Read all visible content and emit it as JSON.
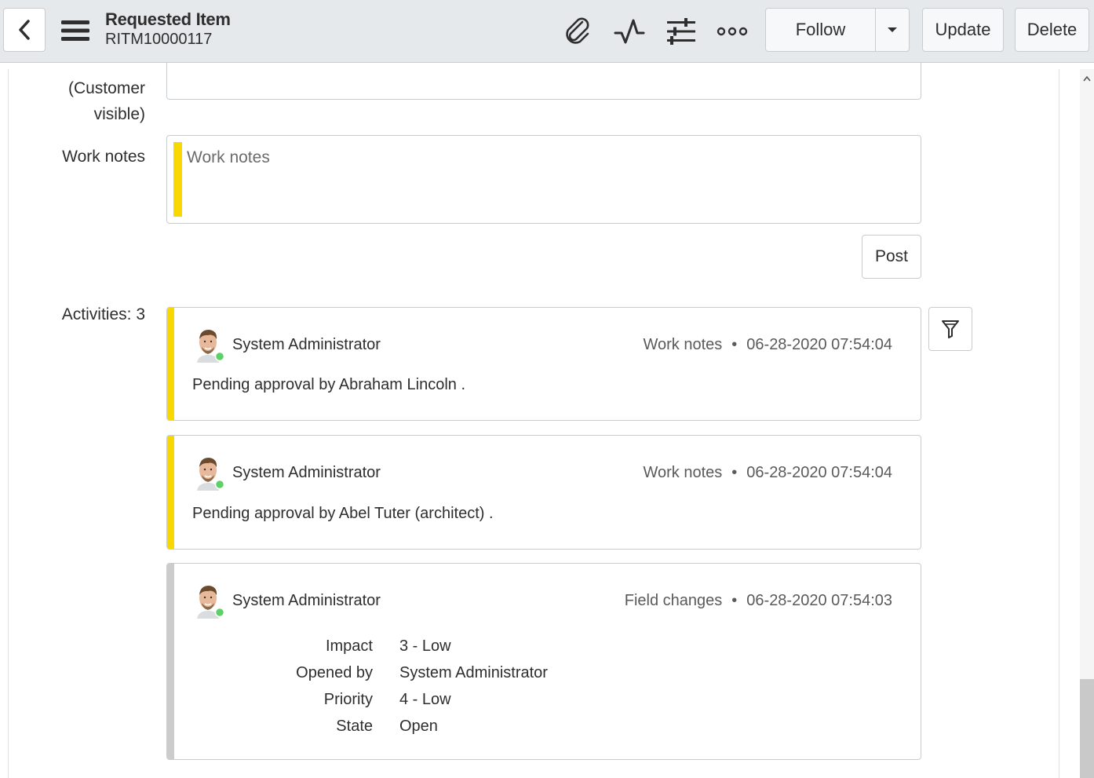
{
  "header": {
    "title": "Requested Item",
    "number": "RITM10000117",
    "follow_label": "Follow",
    "update_label": "Update",
    "delete_label": "Delete"
  },
  "form": {
    "customer_label_line1": "(Customer",
    "customer_label_line2": "visible)",
    "work_notes_label": "Work notes",
    "work_notes_placeholder": "Work notes",
    "post_label": "Post",
    "activities_label": "Activities: 3"
  },
  "colors": {
    "work_notes_accent": "#f8d800",
    "field_change_accent": "#cccccc",
    "presence": "#5fd068"
  },
  "activities": [
    {
      "author": "System Administrator",
      "type": "Work notes",
      "timestamp": "06-28-2020 07:54:04",
      "text": "Pending approval by Abraham Lincoln ."
    },
    {
      "author": "System Administrator",
      "type": "Work notes",
      "timestamp": "06-28-2020 07:54:04",
      "text": "Pending approval by Abel Tuter (architect) ."
    },
    {
      "author": "System Administrator",
      "type": "Field changes",
      "timestamp": "06-28-2020 07:54:03",
      "changes": [
        {
          "field": "Impact",
          "value": "3 - Low"
        },
        {
          "field": "Opened by",
          "value": "System Administrator"
        },
        {
          "field": "Priority",
          "value": "4 - Low"
        },
        {
          "field": "State",
          "value": "Open"
        }
      ]
    }
  ]
}
